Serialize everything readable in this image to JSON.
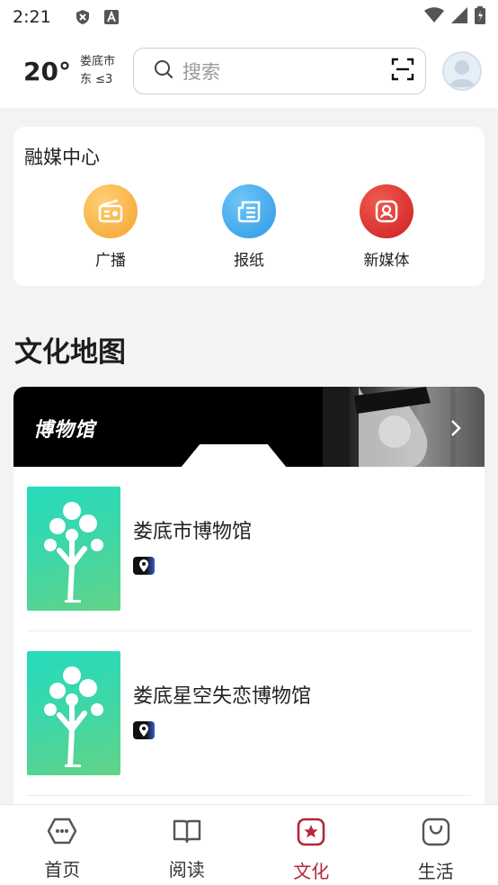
{
  "status_bar": {
    "time": "2:21"
  },
  "header": {
    "temperature": "20°",
    "city": "娄底市",
    "wind": "东 ≤3",
    "search_placeholder": "搜索"
  },
  "media_center": {
    "title": "融媒中心",
    "items": [
      {
        "label": "广播",
        "icon": "radio-icon",
        "color": "#f7a93a"
      },
      {
        "label": "报纸",
        "icon": "newspaper-icon",
        "color": "#36a3ea"
      },
      {
        "label": "新媒体",
        "icon": "new-media-icon",
        "color": "#dd2a2a"
      }
    ]
  },
  "culture_map": {
    "title": "文化地图",
    "banner_title": "博物馆",
    "museums": [
      {
        "name": "娄底市博物馆"
      },
      {
        "name": "娄底星空失恋博物馆"
      }
    ]
  },
  "bottom_nav": {
    "items": [
      {
        "label": "首页",
        "icon": "home-icon"
      },
      {
        "label": "阅读",
        "icon": "book-icon"
      },
      {
        "label": "文化",
        "icon": "culture-icon",
        "active": true
      },
      {
        "label": "生活",
        "icon": "shopping-bag-icon"
      }
    ]
  },
  "colors": {
    "accent": "#b3263b"
  }
}
